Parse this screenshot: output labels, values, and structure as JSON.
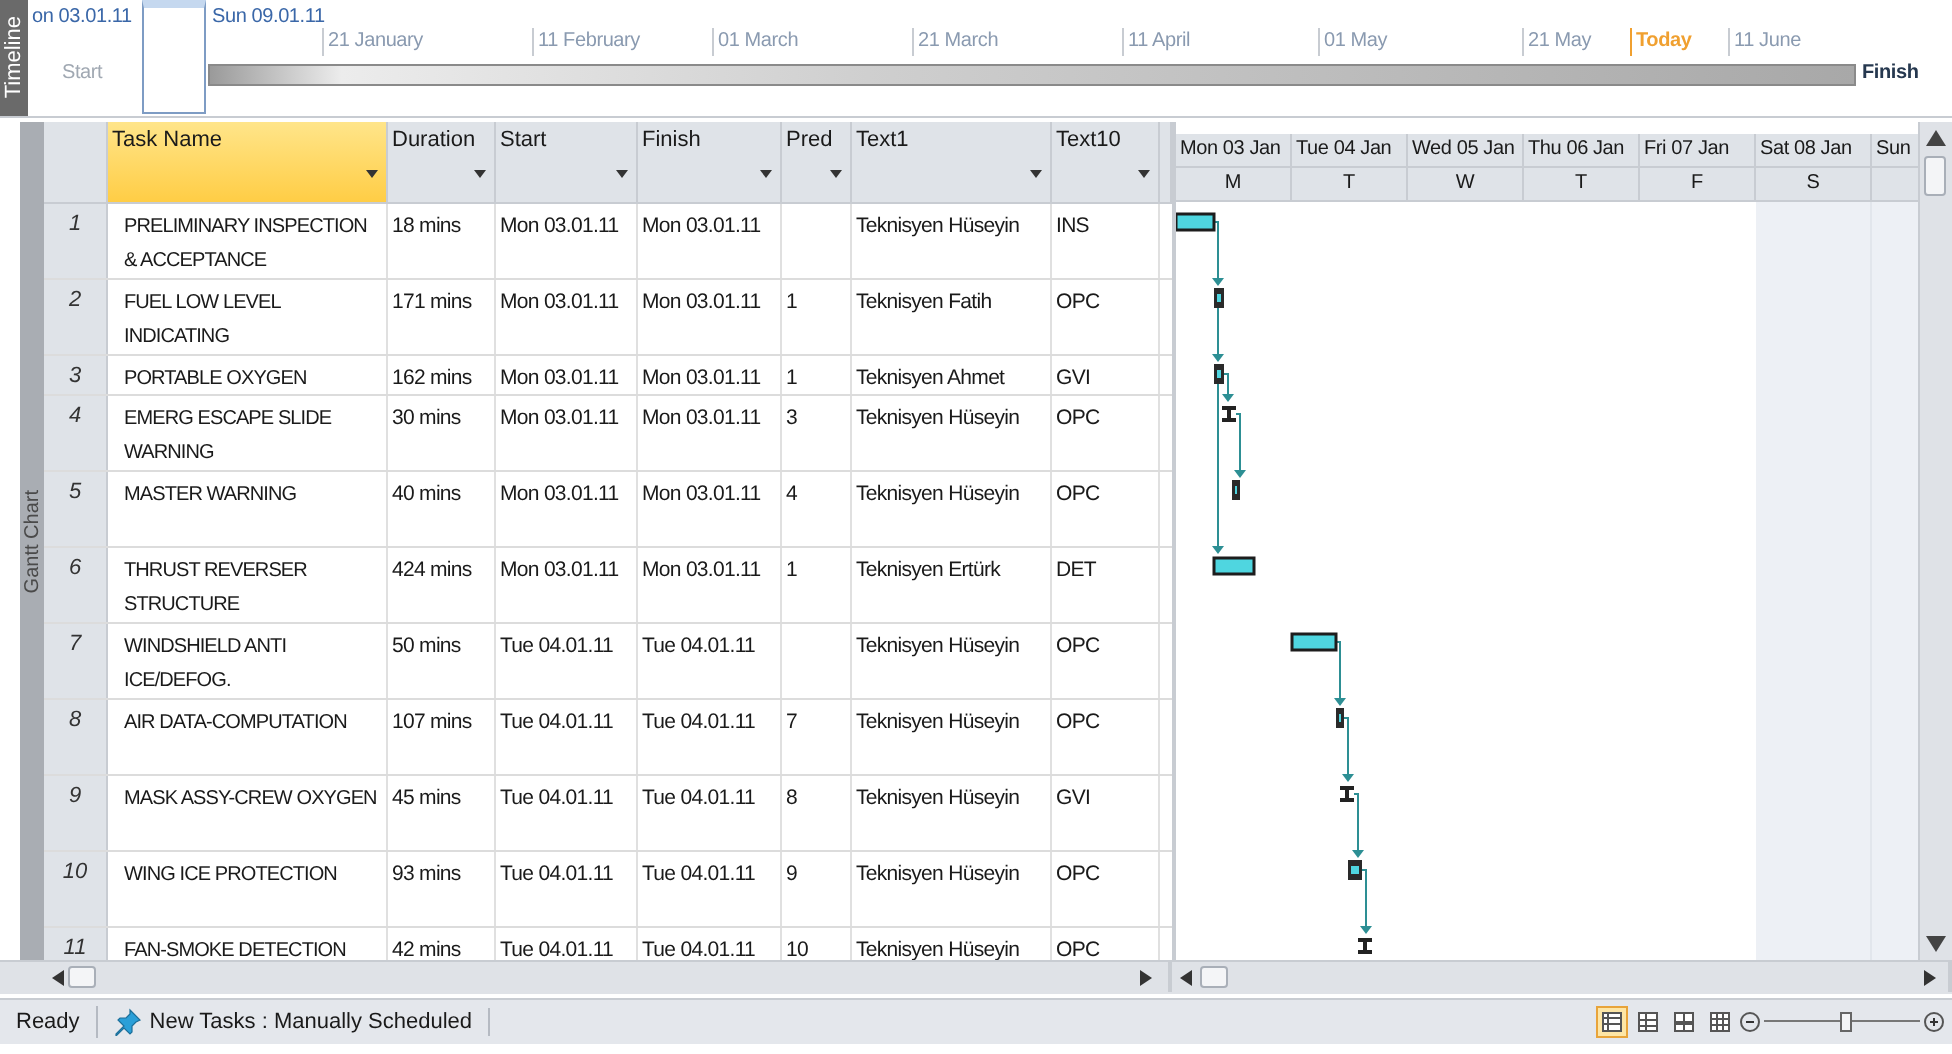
{
  "timeline": {
    "label": "Timeline",
    "range_start": "on 03.01.11",
    "range_end": "Sun 09.01.11",
    "start_label": "Start",
    "finish_label": "Finish",
    "ticks": [
      {
        "label": "21 January",
        "today": false
      },
      {
        "label": "11 February",
        "today": false
      },
      {
        "label": "01 March",
        "today": false
      },
      {
        "label": "21 March",
        "today": false
      },
      {
        "label": "11 April",
        "today": false
      },
      {
        "label": "01 May",
        "today": false
      },
      {
        "label": "21 May",
        "today": false
      },
      {
        "label": "Today",
        "today": true
      },
      {
        "label": "11 June",
        "today": false
      }
    ]
  },
  "view_label": "Gantt Chart",
  "table": {
    "columns": [
      {
        "label": "Task Name",
        "selected": true
      },
      {
        "label": "Duration",
        "selected": false
      },
      {
        "label": "Start",
        "selected": false
      },
      {
        "label": "Finish",
        "selected": false
      },
      {
        "label": "Pred",
        "selected": false
      },
      {
        "label": "Text1",
        "selected": false
      },
      {
        "label": "Text10",
        "selected": false
      }
    ],
    "rows": [
      {
        "id": "1",
        "name": "PRELIMINARY INSPECTION & ACCEPTANCE",
        "duration": "18 mins",
        "start": "Mon 03.01.11",
        "finish": "Mon 03.01.11",
        "text1": "Teknisyen Hüseyin",
        "text10": "INS"
      },
      {
        "id": "2",
        "name": "FUEL LOW LEVEL INDICATING",
        "duration": "171 mins",
        "start": "Mon 03.01.11",
        "finish": "Mon 03.01.11",
        "predecessors": "1",
        "text1": "Teknisyen Fatih",
        "text10": "OPC"
      },
      {
        "id": "3",
        "name": "PORTABLE OXYGEN",
        "duration": "162 mins",
        "start": "Mon 03.01.11",
        "finish": "Mon 03.01.11",
        "predecessors": "1",
        "text1": "Teknisyen Ahmet",
        "text10": "GVI"
      },
      {
        "id": "4",
        "name": "EMERG ESCAPE SLIDE WARNING",
        "duration": "30 mins",
        "start": "Mon 03.01.11",
        "finish": "Mon 03.01.11",
        "predecessors": "3",
        "text1": "Teknisyen Hüseyin",
        "text10": "OPC"
      },
      {
        "id": "5",
        "name": "MASTER WARNING",
        "duration": "40 mins",
        "start": "Mon 03.01.11",
        "finish": "Mon 03.01.11",
        "predecessors": "4",
        "text1": "Teknisyen Hüseyin",
        "text10": "OPC"
      },
      {
        "id": "6",
        "name": "THRUST REVERSER STRUCTURE",
        "duration": "424 mins",
        "start": "Mon 03.01.11",
        "finish": "Mon 03.01.11",
        "predecessors": "1",
        "text1": "Teknisyen Ertürk",
        "text10": "DET"
      },
      {
        "id": "7",
        "name": "WINDSHIELD ANTI ICE/DEFOG.",
        "duration": "50 mins",
        "start": "Tue 04.01.11",
        "finish": "Tue 04.01.11",
        "text1": "Teknisyen Hüseyin",
        "text10": "OPC"
      },
      {
        "id": "8",
        "name": "AIR DATA-COMPUTATION",
        "duration": "107 mins",
        "start": "Tue 04.01.11",
        "finish": "Tue 04.01.11",
        "predecessors": "7",
        "text1": "Teknisyen Hüseyin",
        "text10": "OPC"
      },
      {
        "id": "9",
        "name": "MASK ASSY-CREW OXYGEN",
        "duration": "45 mins",
        "start": "Tue 04.01.11",
        "finish": "Tue 04.01.11",
        "predecessors": "8",
        "text1": "Teknisyen Hüseyin",
        "text10": "GVI"
      },
      {
        "id": "10",
        "name": "WING ICE PROTECTION",
        "duration": "93 mins",
        "start": "Tue 04.01.11",
        "finish": "Tue 04.01.11",
        "predecessors": "9",
        "text1": "Teknisyen Hüseyin",
        "text10": "OPC"
      },
      {
        "id": "11",
        "name": "FAN-SMOKE DETECTION",
        "duration": "42 mins",
        "start": "Tue 04.01.11",
        "finish": "Tue 04.01.11",
        "predecessors": "10",
        "text1": "Teknisyen Hüseyin",
        "text10": "OPC"
      }
    ]
  },
  "gantt": {
    "days": [
      {
        "label": "Mon 03 Jan",
        "letter": "M",
        "weekend": false
      },
      {
        "label": "Tue 04 Jan",
        "letter": "T",
        "weekend": false
      },
      {
        "label": "Wed 05 Jan",
        "letter": "W",
        "weekend": false
      },
      {
        "label": "Thu 06 Jan",
        "letter": "T",
        "weekend": false
      },
      {
        "label": "Fri 07 Jan",
        "letter": "F",
        "weekend": false
      },
      {
        "label": "Sat 08 Jan",
        "letter": "S",
        "weekend": true
      },
      {
        "label": "Sun",
        "weekend": true
      }
    ]
  },
  "status_bar": {
    "status": "Ready",
    "task_mode": "New Tasks : Manually Scheduled",
    "view_buttons": [
      {
        "selected": true
      },
      {
        "selected": false
      },
      {
        "selected": false
      },
      {
        "selected": false
      }
    ],
    "zoom": {
      "level": 0.52
    }
  }
}
